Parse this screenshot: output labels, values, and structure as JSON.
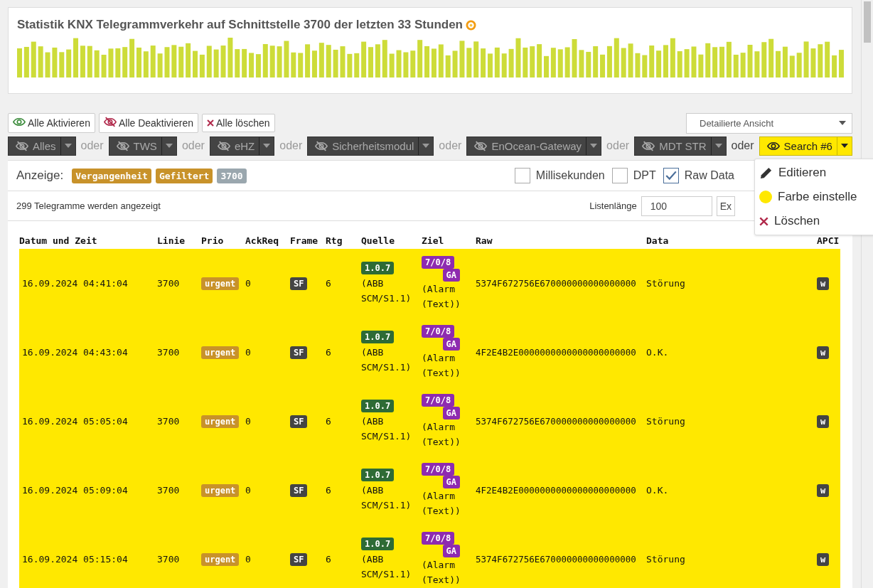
{
  "chart_card": {
    "title": "Statistik KNX Telegrammverkehr auf Schnittstelle 3700 der letzten 33 Stunden"
  },
  "actions": [
    {
      "label": "Alle Aktivieren",
      "kind": "activate"
    },
    {
      "label": "Alle Deaktivieren",
      "kind": "deactivate"
    },
    {
      "label": "Alle löschen",
      "kind": "delete"
    }
  ],
  "view_select": {
    "value": "Detailierte Ansicht"
  },
  "filters": [
    {
      "label": "Alles",
      "active": false
    },
    {
      "label": "TWS",
      "active": false
    },
    {
      "label": "eHZ",
      "active": false
    },
    {
      "label": "Sicherheitsmodul",
      "active": false
    },
    {
      "label": "EnOcean-Gateway",
      "active": false
    },
    {
      "label": "MDT STR",
      "active": false
    },
    {
      "label": "Search #6",
      "active": true,
      "color": "#ffe800"
    }
  ],
  "connectors": [
    "oder",
    "oder",
    "oder",
    "oder",
    "oder",
    "oder"
  ],
  "filter_menu": {
    "items": [
      {
        "label": "Editieren",
        "kind": "edit"
      },
      {
        "label": "Farbe einstelle",
        "kind": "color",
        "color": "#ffe800"
      },
      {
        "label": "Löschen",
        "kind": "delete"
      }
    ]
  },
  "display": {
    "label": "Anzeige:",
    "badges": [
      {
        "label": "Vergangenheit",
        "color": "#c8922a"
      },
      {
        "label": "Gefiltert",
        "color": "#c8922a"
      },
      {
        "label": "3700",
        "color": "#9aa7ae"
      }
    ]
  },
  "options": [
    {
      "label": "Millisekunden",
      "checked": false
    },
    {
      "label": "DPT",
      "checked": false
    },
    {
      "label": "Raw Data",
      "checked": true
    }
  ],
  "count_text": "299 Telegramme werden angezeigt",
  "list_length": {
    "label": "Listenlänge",
    "value": "100"
  },
  "export_button": "Ex",
  "table": {
    "columns": [
      "Datum und Zeit",
      "Linie",
      "Prio",
      "AckReq",
      "Frame",
      "Rtg",
      "Quelle",
      "Ziel",
      "Raw",
      "Data",
      "APCI"
    ],
    "rows": [
      {
        "datetime": "16.09.2024 04:41:04",
        "line": "3700",
        "prio": "urgent",
        "ackreq": "0",
        "frame": "SF",
        "rtg": "6",
        "source_address": "1.0.7",
        "source_name": "(ABB SCM/S1.1)",
        "target_address": "7/0/8",
        "target_type": "GA",
        "target_name": "(Alarm (Text))",
        "raw": "5374F672756E670000000000000000",
        "data": "Störung",
        "apci": "w",
        "color": "#ffe800"
      },
      {
        "datetime": "16.09.2024 04:43:04",
        "line": "3700",
        "prio": "urgent",
        "ackreq": "0",
        "frame": "SF",
        "rtg": "6",
        "source_address": "1.0.7",
        "source_name": "(ABB SCM/S1.1)",
        "target_address": "7/0/8",
        "target_type": "GA",
        "target_name": "(Alarm (Text))",
        "raw": "4F2E4B2E0000000000000000000000",
        "data": "O.K.",
        "apci": "w",
        "color": "#ffe800"
      },
      {
        "datetime": "16.09.2024 05:05:04",
        "line": "3700",
        "prio": "urgent",
        "ackreq": "0",
        "frame": "SF",
        "rtg": "6",
        "source_address": "1.0.7",
        "source_name": "(ABB SCM/S1.1)",
        "target_address": "7/0/8",
        "target_type": "GA",
        "target_name": "(Alarm (Text))",
        "raw": "5374F672756E670000000000000000",
        "data": "Störung",
        "apci": "w",
        "color": "#ffe800"
      },
      {
        "datetime": "16.09.2024 05:09:04",
        "line": "3700",
        "prio": "urgent",
        "ackreq": "0",
        "frame": "SF",
        "rtg": "6",
        "source_address": "1.0.7",
        "source_name": "(ABB SCM/S1.1)",
        "target_address": "7/0/8",
        "target_type": "GA",
        "target_name": "(Alarm (Text))",
        "raw": "4F2E4B2E0000000000000000000000",
        "data": "O.K.",
        "apci": "w",
        "color": "#ffe800"
      },
      {
        "datetime": "16.09.2024 05:15:04",
        "line": "3700",
        "prio": "urgent",
        "ackreq": "0",
        "frame": "SF",
        "rtg": "6",
        "source_address": "1.0.7",
        "source_name": "(ABB SCM/S1.1)",
        "target_address": "7/0/8",
        "target_type": "GA",
        "target_name": "(Alarm (Text))",
        "raw": "5374F672756E670000000000000000",
        "data": "Störung",
        "apci": "w",
        "color": "#ffe800"
      }
    ]
  }
}
